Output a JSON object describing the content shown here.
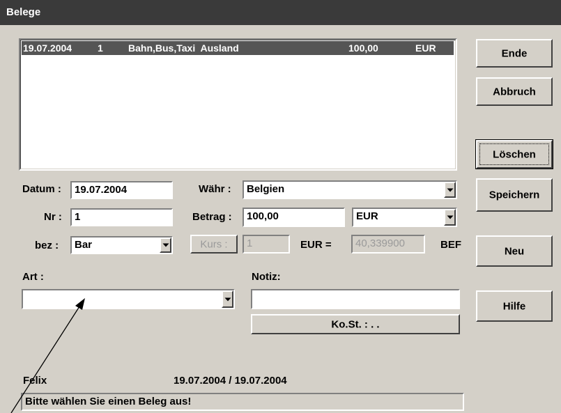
{
  "window": {
    "title": "Belege"
  },
  "list": {
    "rows": [
      {
        "date": "19.07.2004",
        "nr": "1",
        "type": "Bahn,Bus,Taxi  Ausland",
        "amount": "100,00",
        "currency": "EUR"
      }
    ]
  },
  "buttons": {
    "ende": "Ende",
    "abbruch": "Abbruch",
    "loeschen": "Löschen",
    "speichern": "Speichern",
    "neu": "Neu",
    "hilfe": "Hilfe",
    "kurs": "Kurs :",
    "kost": "Ko.St. :  .  ."
  },
  "form": {
    "datum_label": "Datum :",
    "datum_value": "19.07.2004",
    "nr_label": "Nr :",
    "nr_value": "1",
    "bez_label": "bez :",
    "bez_value": "Bar",
    "waehr_label": "Währ :",
    "waehr_value": "Belgien",
    "betrag_label": "Betrag :",
    "betrag_value": "100,00",
    "currency_value": "EUR",
    "kurs_value": "1",
    "eur_eq_label": "EUR =",
    "rate_value": "40,339900",
    "target_currency": "BEF",
    "art_label": "Art :",
    "art_value": "",
    "notiz_label": "Notiz:",
    "notiz_value": ""
  },
  "footer": {
    "user": "Felix",
    "dates": "19.07.2004 / 19.07.2004",
    "status": "Bitte wählen Sie einen Beleg aus!"
  }
}
